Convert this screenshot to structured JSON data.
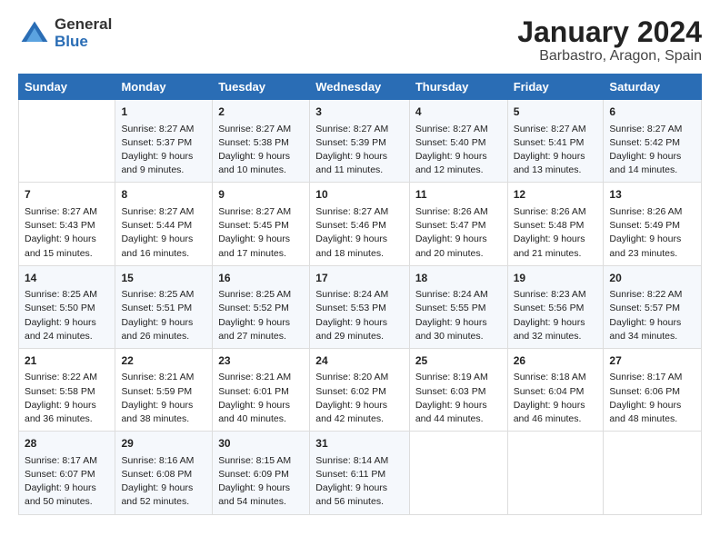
{
  "header": {
    "logo_general": "General",
    "logo_blue": "Blue",
    "title": "January 2024",
    "subtitle": "Barbastro, Aragon, Spain"
  },
  "weekdays": [
    "Sunday",
    "Monday",
    "Tuesday",
    "Wednesday",
    "Thursday",
    "Friday",
    "Saturday"
  ],
  "weeks": [
    [
      {
        "day": "",
        "info": ""
      },
      {
        "day": "1",
        "info": "Sunrise: 8:27 AM\nSunset: 5:37 PM\nDaylight: 9 hours\nand 9 minutes."
      },
      {
        "day": "2",
        "info": "Sunrise: 8:27 AM\nSunset: 5:38 PM\nDaylight: 9 hours\nand 10 minutes."
      },
      {
        "day": "3",
        "info": "Sunrise: 8:27 AM\nSunset: 5:39 PM\nDaylight: 9 hours\nand 11 minutes."
      },
      {
        "day": "4",
        "info": "Sunrise: 8:27 AM\nSunset: 5:40 PM\nDaylight: 9 hours\nand 12 minutes."
      },
      {
        "day": "5",
        "info": "Sunrise: 8:27 AM\nSunset: 5:41 PM\nDaylight: 9 hours\nand 13 minutes."
      },
      {
        "day": "6",
        "info": "Sunrise: 8:27 AM\nSunset: 5:42 PM\nDaylight: 9 hours\nand 14 minutes."
      }
    ],
    [
      {
        "day": "7",
        "info": "Sunrise: 8:27 AM\nSunset: 5:43 PM\nDaylight: 9 hours\nand 15 minutes."
      },
      {
        "day": "8",
        "info": "Sunrise: 8:27 AM\nSunset: 5:44 PM\nDaylight: 9 hours\nand 16 minutes."
      },
      {
        "day": "9",
        "info": "Sunrise: 8:27 AM\nSunset: 5:45 PM\nDaylight: 9 hours\nand 17 minutes."
      },
      {
        "day": "10",
        "info": "Sunrise: 8:27 AM\nSunset: 5:46 PM\nDaylight: 9 hours\nand 18 minutes."
      },
      {
        "day": "11",
        "info": "Sunrise: 8:26 AM\nSunset: 5:47 PM\nDaylight: 9 hours\nand 20 minutes."
      },
      {
        "day": "12",
        "info": "Sunrise: 8:26 AM\nSunset: 5:48 PM\nDaylight: 9 hours\nand 21 minutes."
      },
      {
        "day": "13",
        "info": "Sunrise: 8:26 AM\nSunset: 5:49 PM\nDaylight: 9 hours\nand 23 minutes."
      }
    ],
    [
      {
        "day": "14",
        "info": "Sunrise: 8:25 AM\nSunset: 5:50 PM\nDaylight: 9 hours\nand 24 minutes."
      },
      {
        "day": "15",
        "info": "Sunrise: 8:25 AM\nSunset: 5:51 PM\nDaylight: 9 hours\nand 26 minutes."
      },
      {
        "day": "16",
        "info": "Sunrise: 8:25 AM\nSunset: 5:52 PM\nDaylight: 9 hours\nand 27 minutes."
      },
      {
        "day": "17",
        "info": "Sunrise: 8:24 AM\nSunset: 5:53 PM\nDaylight: 9 hours\nand 29 minutes."
      },
      {
        "day": "18",
        "info": "Sunrise: 8:24 AM\nSunset: 5:55 PM\nDaylight: 9 hours\nand 30 minutes."
      },
      {
        "day": "19",
        "info": "Sunrise: 8:23 AM\nSunset: 5:56 PM\nDaylight: 9 hours\nand 32 minutes."
      },
      {
        "day": "20",
        "info": "Sunrise: 8:22 AM\nSunset: 5:57 PM\nDaylight: 9 hours\nand 34 minutes."
      }
    ],
    [
      {
        "day": "21",
        "info": "Sunrise: 8:22 AM\nSunset: 5:58 PM\nDaylight: 9 hours\nand 36 minutes."
      },
      {
        "day": "22",
        "info": "Sunrise: 8:21 AM\nSunset: 5:59 PM\nDaylight: 9 hours\nand 38 minutes."
      },
      {
        "day": "23",
        "info": "Sunrise: 8:21 AM\nSunset: 6:01 PM\nDaylight: 9 hours\nand 40 minutes."
      },
      {
        "day": "24",
        "info": "Sunrise: 8:20 AM\nSunset: 6:02 PM\nDaylight: 9 hours\nand 42 minutes."
      },
      {
        "day": "25",
        "info": "Sunrise: 8:19 AM\nSunset: 6:03 PM\nDaylight: 9 hours\nand 44 minutes."
      },
      {
        "day": "26",
        "info": "Sunrise: 8:18 AM\nSunset: 6:04 PM\nDaylight: 9 hours\nand 46 minutes."
      },
      {
        "day": "27",
        "info": "Sunrise: 8:17 AM\nSunset: 6:06 PM\nDaylight: 9 hours\nand 48 minutes."
      }
    ],
    [
      {
        "day": "28",
        "info": "Sunrise: 8:17 AM\nSunset: 6:07 PM\nDaylight: 9 hours\nand 50 minutes."
      },
      {
        "day": "29",
        "info": "Sunrise: 8:16 AM\nSunset: 6:08 PM\nDaylight: 9 hours\nand 52 minutes."
      },
      {
        "day": "30",
        "info": "Sunrise: 8:15 AM\nSunset: 6:09 PM\nDaylight: 9 hours\nand 54 minutes."
      },
      {
        "day": "31",
        "info": "Sunrise: 8:14 AM\nSunset: 6:11 PM\nDaylight: 9 hours\nand 56 minutes."
      },
      {
        "day": "",
        "info": ""
      },
      {
        "day": "",
        "info": ""
      },
      {
        "day": "",
        "info": ""
      }
    ]
  ]
}
